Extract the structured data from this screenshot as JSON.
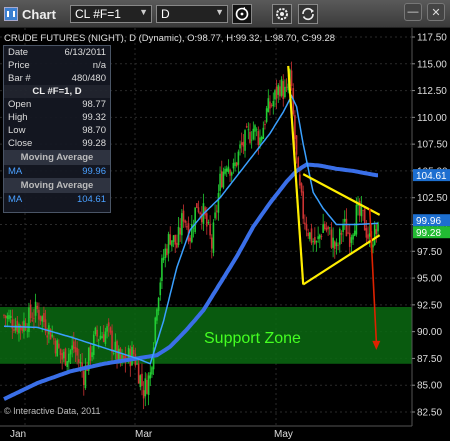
{
  "toolbar": {
    "title": "Chart",
    "symbol": "CL #F=1",
    "period": "D",
    "dropdown_glyph": "▼",
    "icons": [
      "refresh-icon",
      "settings-icon",
      "minimize-icon",
      "close-icon"
    ]
  },
  "header": {
    "line": "CRUDE FUTURES (NIGHT), D (Dynamic), O:98.77, H:99.32, L:98.70, C:99.28"
  },
  "data_panel": {
    "rows": [
      {
        "label": "Date",
        "value": "6/13/2011",
        "ghost": "Moving Average"
      },
      {
        "label": "Price",
        "value": "n/a",
        "ghost": "Moving Average"
      },
      {
        "label": "Bar #",
        "value": "480/480"
      }
    ],
    "symbol_head": "CL #F=1, D",
    "ohlc": [
      {
        "label": "Open",
        "value": "98.77"
      },
      {
        "label": "High",
        "value": "99.32"
      },
      {
        "label": "Low",
        "value": "98.70"
      },
      {
        "label": "Close",
        "value": "99.28"
      }
    ],
    "ma1": {
      "section": "Moving Average",
      "label": "MA",
      "value": "99.96"
    },
    "ma2": {
      "section": "Moving Average",
      "label": "MA",
      "value": "104.61"
    }
  },
  "annotations": {
    "support": "Support Zone",
    "copyright": "© Interactive Data, 2011"
  },
  "colors": {
    "up": "#22cc33",
    "down": "#cc3333",
    "ma_fast": "#3aa0ff",
    "ma_slow": "#3a6fe8",
    "support_fill": "#0a6a12",
    "trendline": "#ffee00",
    "arrow": "#dd2200",
    "tag_ma_slow": "#1d6fd0",
    "tag_ma_fast": "#1d6fd0",
    "tag_last": "#22bb33"
  },
  "chart_data": {
    "type": "candlestick",
    "y_ticks": [
      "117.50",
      "115.00",
      "112.50",
      "110.00",
      "107.50",
      "105.00",
      "102.50",
      "100.00",
      "97.50",
      "95.00",
      "92.50",
      "90.00",
      "87.50",
      "85.00",
      "82.50"
    ],
    "x_ticks": [
      "Jan",
      "Mar",
      "May"
    ],
    "ylim": [
      81.5,
      119
    ],
    "last_price_tags": [
      {
        "value": "104.61",
        "series": "ma_slow",
        "y": 104.61
      },
      {
        "value": "99.96",
        "series": "ma_fast",
        "y": 100.4
      },
      {
        "value": "99.28",
        "series": "close",
        "y": 99.28
      }
    ],
    "support_zone": [
      87.0,
      92.3
    ],
    "close_anchors": [
      [
        0,
        91.5
      ],
      [
        10,
        90.5
      ],
      [
        20,
        92
      ],
      [
        28,
        90
      ],
      [
        35,
        87.5
      ],
      [
        42,
        88.5
      ],
      [
        48,
        86
      ],
      [
        55,
        89.5
      ],
      [
        62,
        90
      ],
      [
        70,
        87
      ],
      [
        78,
        88
      ],
      [
        84,
        84.5
      ],
      [
        88,
        86
      ],
      [
        92,
        93
      ],
      [
        96,
        97
      ],
      [
        100,
        99
      ],
      [
        104,
        98
      ],
      [
        108,
        101
      ],
      [
        112,
        99
      ],
      [
        116,
        102
      ],
      [
        120,
        101
      ],
      [
        125,
        98
      ],
      [
        130,
        104
      ],
      [
        134,
        106
      ],
      [
        138,
        105
      ],
      [
        142,
        107
      ],
      [
        146,
        108
      ],
      [
        150,
        109
      ],
      [
        154,
        108
      ],
      [
        158,
        110.5
      ],
      [
        162,
        111.5
      ],
      [
        166,
        113
      ],
      [
        170,
        112
      ],
      [
        172,
        114
      ],
      [
        174,
        110
      ],
      [
        177,
        104
      ],
      [
        180,
        101
      ],
      [
        184,
        99
      ],
      [
        188,
        98
      ],
      [
        192,
        100
      ],
      [
        196,
        99
      ],
      [
        200,
        97.5
      ],
      [
        204,
        100
      ],
      [
        208,
        99
      ],
      [
        212,
        101
      ],
      [
        216,
        100.5
      ],
      [
        220,
        98.5
      ],
      [
        224,
        99.3
      ]
    ],
    "ma_fast_anchors": [
      [
        0,
        90.5
      ],
      [
        20,
        90.4
      ],
      [
        40,
        89.5
      ],
      [
        60,
        88.5
      ],
      [
        80,
        87.5
      ],
      [
        88,
        87
      ],
      [
        96,
        91
      ],
      [
        104,
        96
      ],
      [
        112,
        99.5
      ],
      [
        120,
        101
      ],
      [
        130,
        102.5
      ],
      [
        140,
        104.5
      ],
      [
        150,
        106.5
      ],
      [
        160,
        108.5
      ],
      [
        168,
        110.5
      ],
      [
        173,
        112
      ],
      [
        176,
        111
      ],
      [
        180,
        107.5
      ],
      [
        186,
        103
      ],
      [
        192,
        101.5
      ],
      [
        200,
        100
      ],
      [
        212,
        100
      ],
      [
        224,
        100.1
      ]
    ],
    "ma_slow_anchors": [
      [
        0,
        83.7
      ],
      [
        20,
        85.2
      ],
      [
        40,
        86.3
      ],
      [
        60,
        87
      ],
      [
        80,
        87.5
      ],
      [
        92,
        87.8
      ],
      [
        100,
        88.6
      ],
      [
        110,
        90.2
      ],
      [
        120,
        92
      ],
      [
        130,
        94.5
      ],
      [
        140,
        97
      ],
      [
        150,
        99.8
      ],
      [
        160,
        102
      ],
      [
        170,
        104
      ],
      [
        176,
        105
      ],
      [
        182,
        105.6
      ],
      [
        190,
        105.5
      ],
      [
        200,
        105.2
      ],
      [
        210,
        105
      ],
      [
        224,
        104.6
      ]
    ],
    "trend_lines": [
      {
        "from": [
          171,
          114.8
        ],
        "to": [
          180,
          94.4
        ]
      },
      {
        "from": [
          180,
          94.4
        ],
        "to": [
          226,
          99.0
        ]
      },
      {
        "from": [
          180,
          104.7
        ],
        "to": [
          226,
          100.9
        ]
      }
    ],
    "arrow": {
      "from": [
        220,
        101.5
      ],
      "to": [
        224,
        88.3
      ]
    }
  }
}
